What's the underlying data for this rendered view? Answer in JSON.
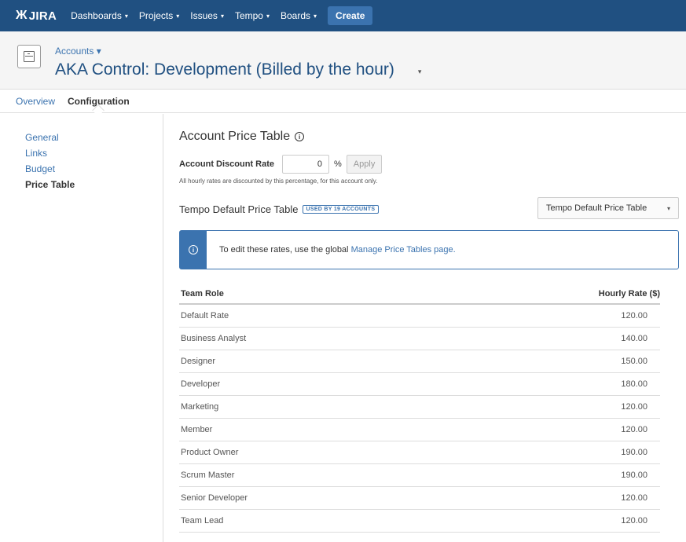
{
  "topnav": {
    "logo": "JIRA",
    "logo_mark": "Ж",
    "items": [
      {
        "label": "Dashboards"
      },
      {
        "label": "Projects"
      },
      {
        "label": "Issues"
      },
      {
        "label": "Tempo"
      },
      {
        "label": "Boards"
      }
    ],
    "caret": "▾",
    "create_label": "Create"
  },
  "project": {
    "parent_label": "Accounts ▾",
    "title": "AKA Control: Development (Billed by the hour)",
    "title_caret": "▾"
  },
  "tabs": [
    {
      "label": "Overview",
      "active": false
    },
    {
      "label": "Configuration",
      "active": true
    }
  ],
  "sidebar": {
    "items": [
      {
        "label": "General",
        "active": false
      },
      {
        "label": "Links",
        "active": false
      },
      {
        "label": "Budget",
        "active": false
      },
      {
        "label": "Price Table",
        "active": true
      }
    ]
  },
  "main": {
    "title": "Account Price Table",
    "info_glyph": "i",
    "discount": {
      "label": "Account Discount Rate",
      "value": "0",
      "unit": "%",
      "apply_label": "Apply",
      "help": "All hourly rates are discounted by this percentage, for this account only."
    },
    "price_table": {
      "title": "Tempo Default Price Table",
      "badge": "USED BY 19 ACCOUNTS",
      "select_value": "Tempo Default Price Table",
      "select_caret": "▾"
    },
    "notice": {
      "icon_glyph": "i",
      "text": "To edit these rates, use the global",
      "link": "Manage Price Tables page."
    },
    "table": {
      "col_role": "Team Role",
      "col_rate": "Hourly Rate ($)",
      "rows": [
        {
          "role": "Default Rate",
          "rate": "120.00"
        },
        {
          "role": "Business Analyst",
          "rate": "140.00"
        },
        {
          "role": "Designer",
          "rate": "150.00"
        },
        {
          "role": "Developer",
          "rate": "180.00"
        },
        {
          "role": "Marketing",
          "rate": "120.00"
        },
        {
          "role": "Member",
          "rate": "120.00"
        },
        {
          "role": "Product Owner",
          "rate": "190.00"
        },
        {
          "role": "Scrum Master",
          "rate": "190.00"
        },
        {
          "role": "Senior Developer",
          "rate": "120.00"
        },
        {
          "role": "Team Lead",
          "rate": "120.00"
        }
      ]
    }
  }
}
